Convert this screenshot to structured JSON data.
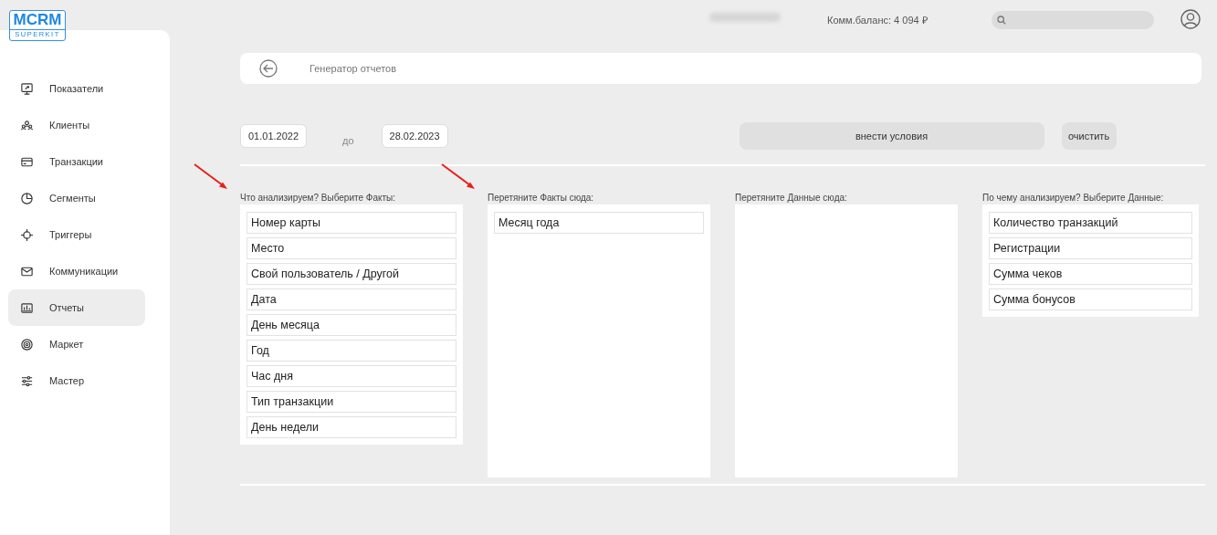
{
  "logo": {
    "title": "MCRM",
    "subtitle": "SUPERKIT"
  },
  "header": {
    "balance": "Комм.баланс: 4 094 ₽"
  },
  "sidebar": {
    "items": [
      {
        "label": "Показатели",
        "selected": false
      },
      {
        "label": "Клиенты",
        "selected": false
      },
      {
        "label": "Транзакции",
        "selected": false
      },
      {
        "label": "Сегменты",
        "selected": false
      },
      {
        "label": "Триггеры",
        "selected": false
      },
      {
        "label": "Коммуникации",
        "selected": false
      },
      {
        "label": "Отчеты",
        "selected": true
      },
      {
        "label": "Маркет",
        "selected": false
      },
      {
        "label": "Мастер",
        "selected": false
      }
    ]
  },
  "page_header": {
    "title": "Генератор отчетов"
  },
  "filters": {
    "date_from": "01.01.2022",
    "separator": "до",
    "date_to": "28.02.2023",
    "apply_button": "внести условия",
    "clear_button": "очистить"
  },
  "columns": [
    {
      "title": "Что анализируем? Выберите Факты:",
      "kind": "source",
      "arrow": true,
      "items": [
        "Номер карты",
        "Место",
        "Свой пользователь / Другой",
        "Дата",
        "День месяца",
        "Год",
        "Час дня",
        "Тип транзакции",
        "День недели"
      ]
    },
    {
      "title": "Перетяните Факты сюда:",
      "kind": "drop",
      "arrow": true,
      "items": [
        "Месяц года"
      ]
    },
    {
      "title": "Перетяните Данные сюда:",
      "kind": "drop",
      "arrow": false
    },
    {
      "title": "По чему анализируем? Выберите Данные:",
      "kind": "source",
      "arrow": false,
      "items": [
        "Количество транзакций",
        "Регистрации",
        "Сумма чеков",
        "Сумма бонусов"
      ]
    }
  ]
}
